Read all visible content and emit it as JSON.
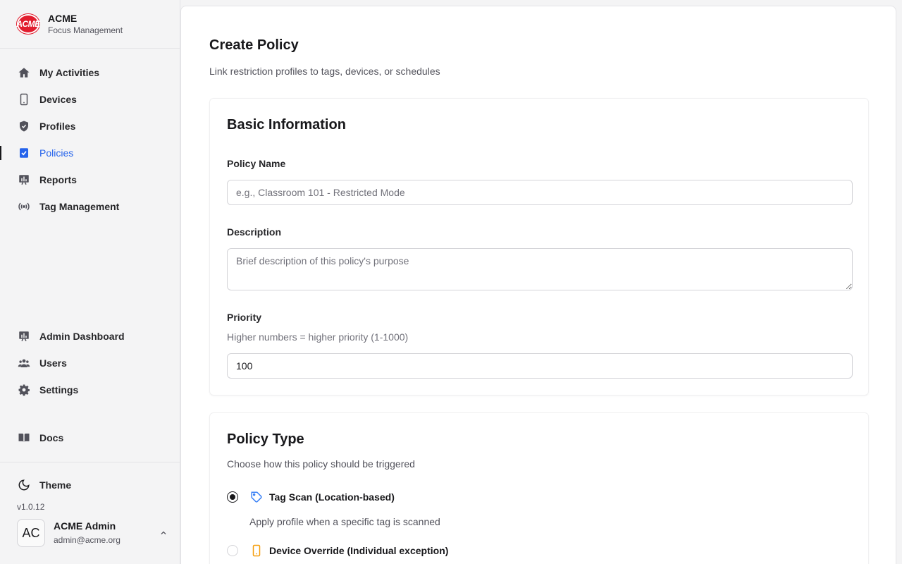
{
  "brand": {
    "logo_text": "ACME",
    "name": "ACME",
    "subtitle": "Focus Management"
  },
  "nav_main": [
    {
      "label": "My Activities",
      "icon": "home-icon"
    },
    {
      "label": "Devices",
      "icon": "phone-icon"
    },
    {
      "label": "Profiles",
      "icon": "shield-icon"
    },
    {
      "label": "Policies",
      "icon": "checklist-icon",
      "active": true
    },
    {
      "label": "Reports",
      "icon": "chart-icon"
    },
    {
      "label": "Tag Management",
      "icon": "broadcast-icon"
    }
  ],
  "nav_admin": [
    {
      "label": "Admin Dashboard",
      "icon": "dashboard-icon"
    },
    {
      "label": "Users",
      "icon": "users-icon"
    },
    {
      "label": "Settings",
      "icon": "gear-icon"
    }
  ],
  "nav_docs": {
    "label": "Docs",
    "icon": "book-icon"
  },
  "footer": {
    "theme_label": "Theme",
    "version": "v1.0.12",
    "user": {
      "initials": "AC",
      "name": "ACME Admin",
      "email": "admin@acme.org"
    }
  },
  "page": {
    "title": "Create Policy",
    "subtitle": "Link restriction profiles to tags, devices, or schedules"
  },
  "basic_info": {
    "title": "Basic Information",
    "name_label": "Policy Name",
    "name_placeholder": "e.g., Classroom 101 - Restricted Mode",
    "desc_label": "Description",
    "desc_placeholder": "Brief description of this policy's purpose",
    "priority_label": "Priority",
    "priority_hint": "Higher numbers = higher priority (1-1000)",
    "priority_value": "100"
  },
  "policy_type": {
    "title": "Policy Type",
    "subtitle": "Choose how this policy should be triggered",
    "options": [
      {
        "label": "Tag Scan (Location-based)",
        "description": "Apply profile when a specific tag is scanned",
        "checked": true,
        "icon": "tag-icon"
      },
      {
        "label": "Device Override (Individual exception)",
        "checked": false,
        "icon": "phone-icon"
      }
    ]
  },
  "colors": {
    "accent": "#2563eb",
    "tag_icon": "#3b82f6",
    "device_icon": "#f59e0b",
    "brand_red": "#e11d2e"
  }
}
